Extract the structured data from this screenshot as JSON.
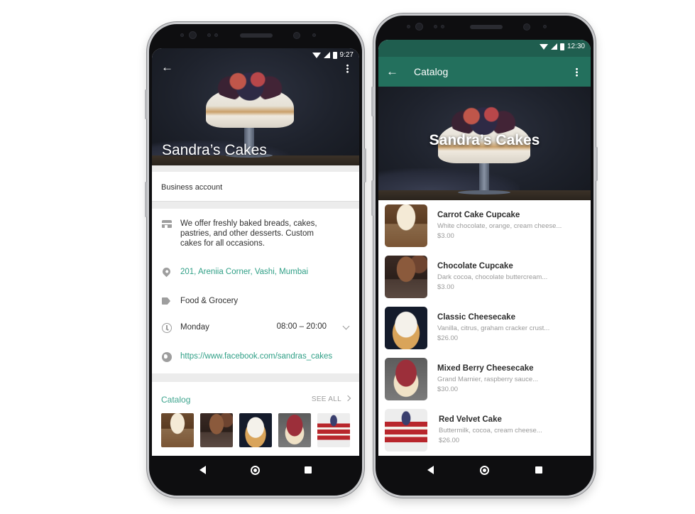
{
  "profile_screen": {
    "status_bar": {
      "time": "9:27"
    },
    "business_name": "Sandra’s Cakes",
    "account_type": "Business account",
    "description": "We offer freshly baked breads, cakes, pastries, and other desserts. Custom cakes for all occasions.",
    "address": "201, Areniia Corner, Vashi, Mumbai",
    "category": "Food & Grocery",
    "hours": {
      "day": "Monday",
      "time": "08:00 – 20:00"
    },
    "website": "https://www.facebook.com/sandras_cakes",
    "catalog": {
      "label": "Catalog",
      "see_all": "SEE ALL",
      "thumbnails": [
        "Carrot Cake Cupcake",
        "Chocolate Cupcake",
        "Classic Cheesecake",
        "Mixed Berry Cheesecake",
        "Red Velvet Cake"
      ]
    },
    "icons": {
      "back": "arrow-left-icon",
      "menu": "more-vertical-icon",
      "description": "store-icon",
      "address": "location-pin-icon",
      "category": "tag-icon",
      "hours": "clock-icon",
      "website": "globe-icon",
      "hours_expand": "chevron-down-icon",
      "see_all": "chevron-right-icon"
    }
  },
  "catalog_screen": {
    "status_bar": {
      "time": "12:30"
    },
    "toolbar_title": "Catalog",
    "hero_title": "Sandra’s Cakes",
    "products": [
      {
        "name": "Carrot Cake Cupcake",
        "description": "White chocolate, orange, cream cheese...",
        "price": "$3.00"
      },
      {
        "name": "Chocolate Cupcake",
        "description": "Dark cocoa, chocolate buttercream...",
        "price": "$3.00"
      },
      {
        "name": "Classic Cheesecake",
        "description": "Vanilla, citrus, graham cracker crust...",
        "price": "$26.00"
      },
      {
        "name": "Mixed Berry Cheesecake",
        "description": "Grand Marnier, raspberry sauce...",
        "price": "$30.00"
      },
      {
        "name": "Red Velvet Cake",
        "description": "Buttermilk, cocoa, cream cheese...",
        "price": "$26.00"
      }
    ]
  },
  "colors": {
    "whatsapp_teal": "#23705d",
    "whatsapp_teal_dark": "#1f5e4f",
    "link_green": "#2f9f86",
    "secondary_text": "#9a9a9a"
  },
  "system_nav": {
    "back": "nav-back-icon",
    "home": "nav-home-icon",
    "recents": "nav-recents-icon"
  }
}
